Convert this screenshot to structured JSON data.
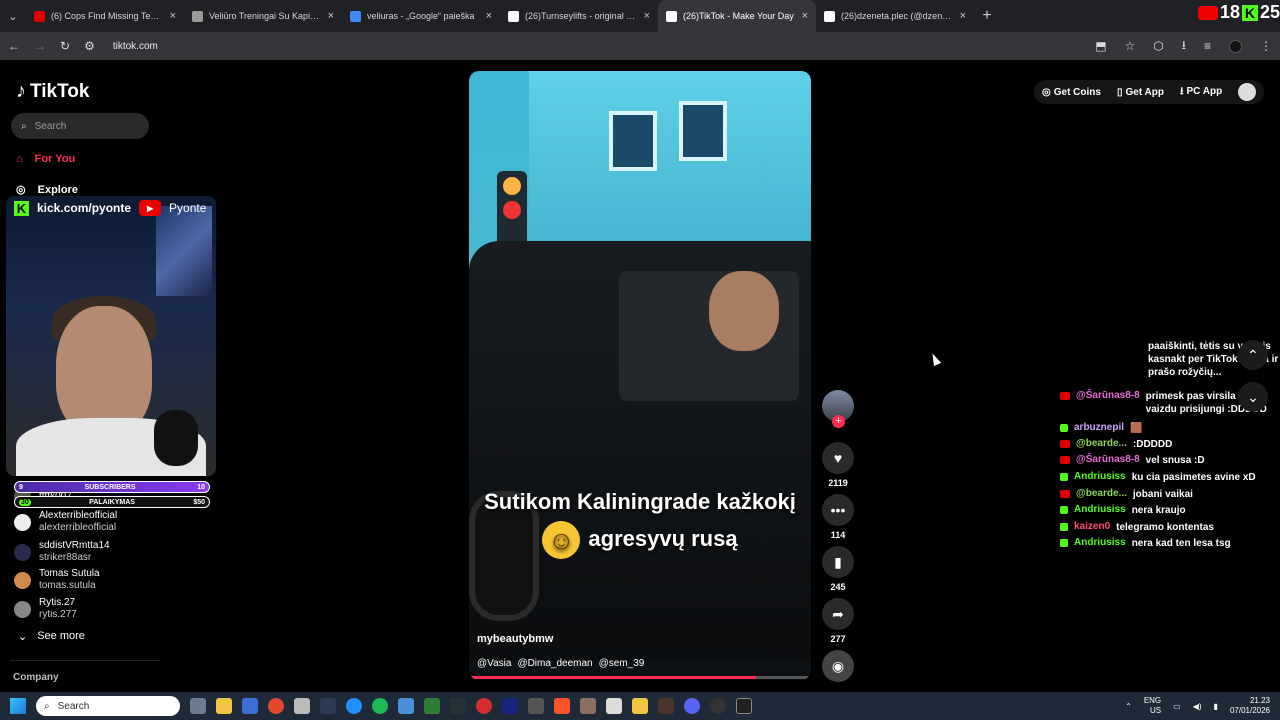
{
  "browser": {
    "tabs": [
      {
        "title": "(6) Cops Find Missing Teen's Bo",
        "color": "#e00000"
      },
      {
        "title": "Veliūro Treningai Su Kapišonu -",
        "color": "#9a9a9a"
      },
      {
        "title": "veliuras - „Google“ paieška",
        "color": "#4285f4"
      },
      {
        "title": "(26)Turnseylifts - original sound",
        "color": "#ffffff"
      },
      {
        "title": "(26)TikTok - Make Your Day",
        "color": "#ffffff",
        "active": true
      },
      {
        "title": "(26)dzeneta.plec (@dzeneta.ple",
        "color": "#ffffff"
      }
    ],
    "url": "tiktok.com",
    "badge": {
      "age": "18",
      "count": "25"
    }
  },
  "sidebar": {
    "logo": "TikTok",
    "search_placeholder": "Search",
    "nav": [
      {
        "label": "For You",
        "icon": "home-icon",
        "active": true
      },
      {
        "label": "Explore",
        "icon": "compass-icon"
      }
    ],
    "following": [
      {
        "name": "ttttk007",
        "user": "",
        "color": "#555"
      },
      {
        "name": "Alexterribleofficial",
        "user": "alexterribleofficial",
        "color": "#eee"
      },
      {
        "name": "sddistVRmtta14",
        "user": "striker88asr",
        "color": "#2a2a4a"
      },
      {
        "name": "Tomas Sutula",
        "user": "tomas.sutula",
        "color": "#d08a4a"
      },
      {
        "name": "Rytis.27",
        "user": "rytis.277",
        "color": "#888"
      }
    ],
    "see_more": "See more",
    "company": "Company"
  },
  "stream_overlay": {
    "kick": "kick.com/pyonte",
    "youtube": "Pyonte",
    "subs_goal": {
      "left": "9",
      "label": "SUBSCRIBERS",
      "right": "10",
      "progress": 0.9
    },
    "donation_goal": {
      "left": "30",
      "label": "PALAIKYMAS",
      "right": "$50",
      "progress": 0.3
    }
  },
  "video": {
    "caption_line1": "Sutikom Kaliningrade kažkokį",
    "caption_line2": "agresyvų rusą",
    "author": "mybeautybmw",
    "tags": [
      "@Vasia",
      "@Dima_deeman",
      "@sem_39"
    ],
    "progress": 0.84
  },
  "actions": {
    "likes": "2119",
    "comments": "114",
    "saves": "245",
    "shares": "277"
  },
  "top_actions": {
    "coins": "Get Coins",
    "app": "Get App",
    "pc": "PC App"
  },
  "chat": {
    "lines": [
      {
        "platform": "",
        "user": "",
        "user_color": "#fff",
        "msg": "paaiškinti, tėtis su vaikais kasnakt per TikTok šneka ir prašo rožyčių..."
      },
      {
        "platform": "youtube",
        "user": "@Šarūnas8-8",
        "user_color": "#e86ad6",
        "msg": "primesk pas virsila su vaizdu prisijungi :DDDDD"
      },
      {
        "platform": "kick",
        "user": "arbuznepil",
        "user_color": "#c9a2ff",
        "msg": "🟫"
      },
      {
        "platform": "youtube",
        "user": "@bearde...",
        "user_color": "#8bd45a",
        "msg": ":DDDDD"
      },
      {
        "platform": "youtube",
        "user": "@Šarūnas8-8",
        "user_color": "#e86ad6",
        "msg": "vel snusa :D"
      },
      {
        "platform": "kick",
        "user": "Andriusiss",
        "user_color": "#53fc18",
        "msg": "ku cia pasimetes avine xD"
      },
      {
        "platform": "youtube",
        "user": "@bearde...",
        "user_color": "#8bd45a",
        "msg": "jobani vaikai"
      },
      {
        "platform": "kick",
        "user": "Andriusiss",
        "user_color": "#53fc18",
        "msg": "nera kraujo"
      },
      {
        "platform": "kick",
        "user": "kaizen0",
        "user_color": "#ff4d6d",
        "msg": "telegramo kontentas"
      },
      {
        "platform": "kick",
        "user": "Andriusiss",
        "user_color": "#53fc18",
        "msg": "nera kad ten lesa tsg"
      }
    ]
  },
  "taskbar": {
    "search": "Search",
    "lang": "ENG",
    "region": "US",
    "time": "21.23",
    "date": "07/01/2026"
  },
  "colors": {
    "accent": "#fe2c55",
    "kick": "#53fc18",
    "youtube": "#e00000"
  }
}
